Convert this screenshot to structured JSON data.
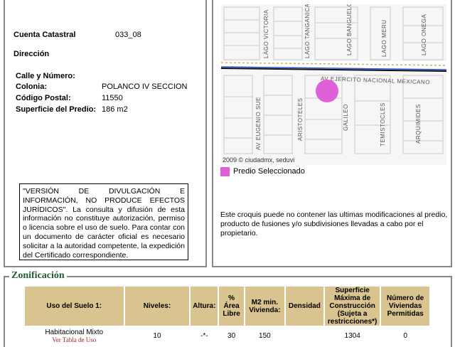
{
  "info": {
    "cuenta_label": "Cuenta Catastral",
    "cuenta_value": "033_08",
    "direccion_label": "Dirección",
    "calle_label": "Calle y Número:",
    "calle_value": "",
    "colonia_label": "Colonia:",
    "colonia_value": "POLANCO IV SECCION",
    "cp_label": "Código Postal:",
    "cp_value": "11550",
    "superficie_label": "Superficie del Predio:",
    "superficie_value": "186 m2",
    "disclaimer": "\"VERSIÓN DE DIVULGACIÓN E INFORMACIÓN, NO PRODUCE EFECTOS JURÍDICOS\". La consulta y difusión de esta información no constituye autorización, permiso o licencia sobre el uso de suelo. Para contar con un documento de carácter oficial es necesario solicitar a la autoridad competente, la expedición del Certificado correspondiente."
  },
  "map": {
    "streets": {
      "lago_victoria": "LAGO VICTORIA",
      "lago_tanganica": "LAGO TANGANICA",
      "lago_banguelo": "LAGO BANGUELO",
      "lago_meru": "LAGO MERU",
      "lago_onega": "LAGO ONEGA",
      "ejercito": "AV EJERCITO NACIONAL MEXICANO",
      "eugenio_sue": "AV EUGENIO SUE",
      "aristoteles": "ARISTOTELES",
      "galileo": "GALILEO",
      "temistocles": "TEMISTOCLES",
      "arquimides": "ARQUIMIDES"
    },
    "copyright": "2009 © ciudadmx, seduvi",
    "marker_color": "#e060d8",
    "legend_label": "Predio Seleccionado",
    "note": "Este croquis puede no contener las ultimas modificaciones al predio, producto de fusiones y/o subdivisiones llevadas a cabo por el propietario."
  },
  "zonificacion": {
    "title": "Zonificación",
    "headers": {
      "uso": "Uso del Suelo 1:",
      "niveles": "Niveles:",
      "altura": "Altura:",
      "area_libre": "% Área Libre",
      "m2_min": "M2 min. Vivienda:",
      "densidad": "Densidad",
      "superficie_max": "Superficie Máxima de Construcción (Sujeta a restricciones*)",
      "num_viviendas": "Número de Viviendas Permitidas"
    },
    "row": {
      "uso": "Habitacional Mixto",
      "uso_link": "Ver Tabla de Uso",
      "niveles": "10",
      "altura": "-*-",
      "area_libre": "30",
      "m2_min": "150",
      "densidad": "",
      "superficie_max": "1304",
      "num_viviendas": "0"
    }
  },
  "colors": {
    "header_bg": "#d9c48f",
    "title_green": "#1e5f3a",
    "link_red": "#aa1e1e"
  }
}
